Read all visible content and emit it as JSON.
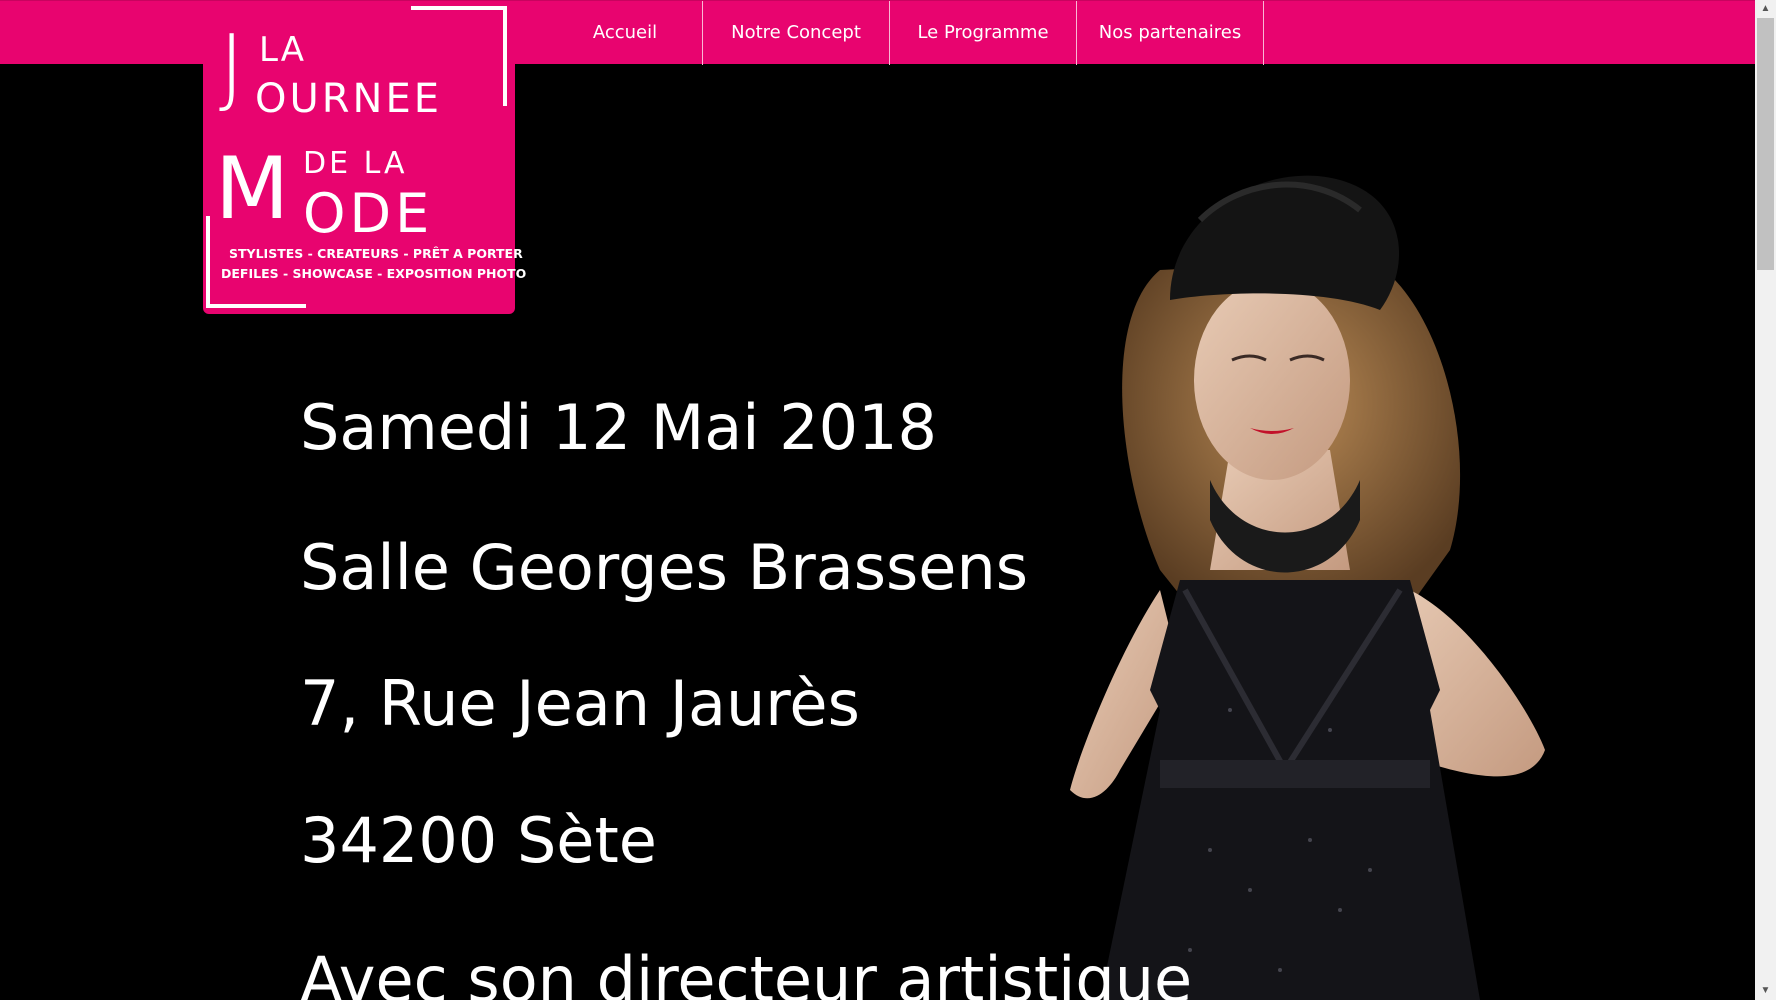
{
  "nav": {
    "items": [
      {
        "label": "Accueil"
      },
      {
        "label": "Notre Concept"
      },
      {
        "label": "Le Programme"
      },
      {
        "label": "Nos partenaires"
      }
    ]
  },
  "logo": {
    "j": "J",
    "la": "LA",
    "ournee": "OURNEE",
    "m": "M",
    "de_la": "DE LA",
    "ode": "ODE",
    "tagline_1": "STYLISTES - CREATEURS - PRÊT A PORTER",
    "tagline_2": "DEFILES - SHOWCASE - EXPOSITION PHOTO"
  },
  "main": {
    "lines": [
      "Samedi 12 Mai 2018",
      "Salle Georges Brassens",
      "7, Rue Jean Jaurès",
      "34200 Sète",
      "Avec son directeur artistique"
    ]
  },
  "colors": {
    "brand_pink": "#e8046f",
    "background": "#000000"
  }
}
